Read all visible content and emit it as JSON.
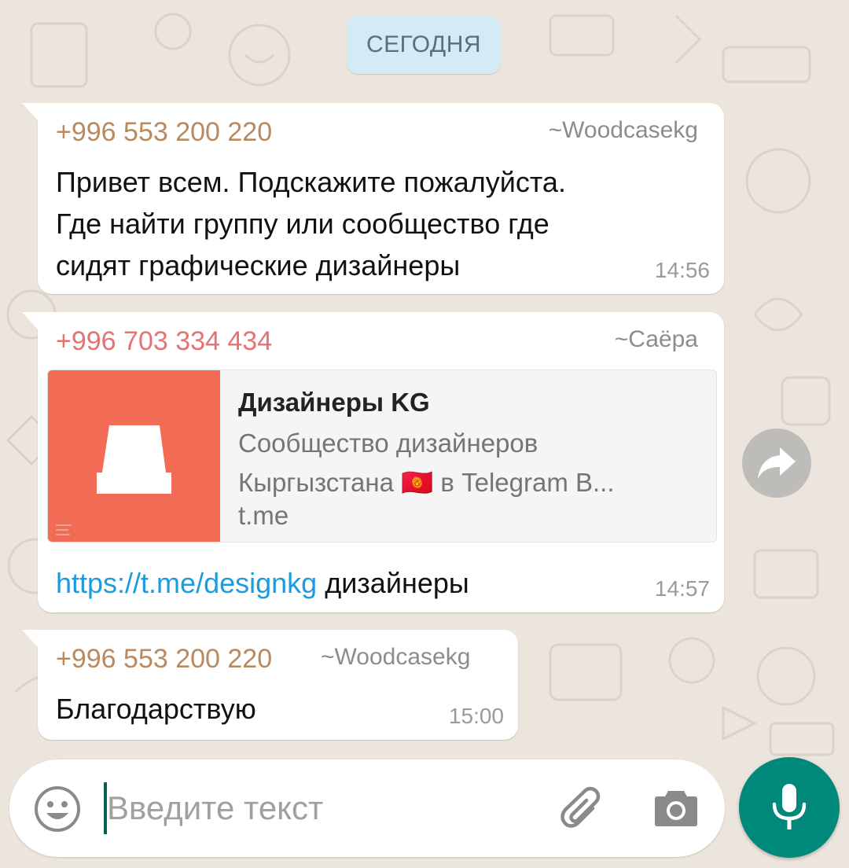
{
  "date_chip": "СЕГОДНЯ",
  "messages": [
    {
      "sender": "+996 553 200 220",
      "alias": "~Woodcasekg",
      "sender_color": "#b98a5f",
      "lines": [
        "Привет всем. Подскажите пожалуйста.",
        "Где найти группу или сообщество где",
        "сидят графические дизайнеры"
      ],
      "time": "14:56"
    },
    {
      "sender": "+996 703 334 434",
      "alias": "~Саёра",
      "sender_color": "#e57373",
      "preview": {
        "title": "Дизайнеры KG",
        "desc_line1": "Сообщество дизайнеров",
        "desc_line2": "Кыргызстана 🇰🇬 в Telegram   В...",
        "domain": "t.me",
        "thumb_color": "#f26b55"
      },
      "link": "https://t.me/designkg",
      "text_after_link": " дизайнеры",
      "time": "14:57"
    },
    {
      "sender": "+996 553 200 220",
      "alias": "~Woodcasekg",
      "sender_color": "#b98a5f",
      "text": "Благодарствую",
      "time": "15:00"
    }
  ],
  "input": {
    "placeholder": "Введите текст",
    "value": ""
  },
  "icons": {
    "forward": "forward-icon",
    "emoji": "emoji-icon",
    "attach": "paperclip-icon",
    "camera": "camera-icon",
    "mic": "mic-icon"
  },
  "colors": {
    "wallpaper": "#ece5dd",
    "accent": "#00897b",
    "link": "#1e9adf"
  }
}
